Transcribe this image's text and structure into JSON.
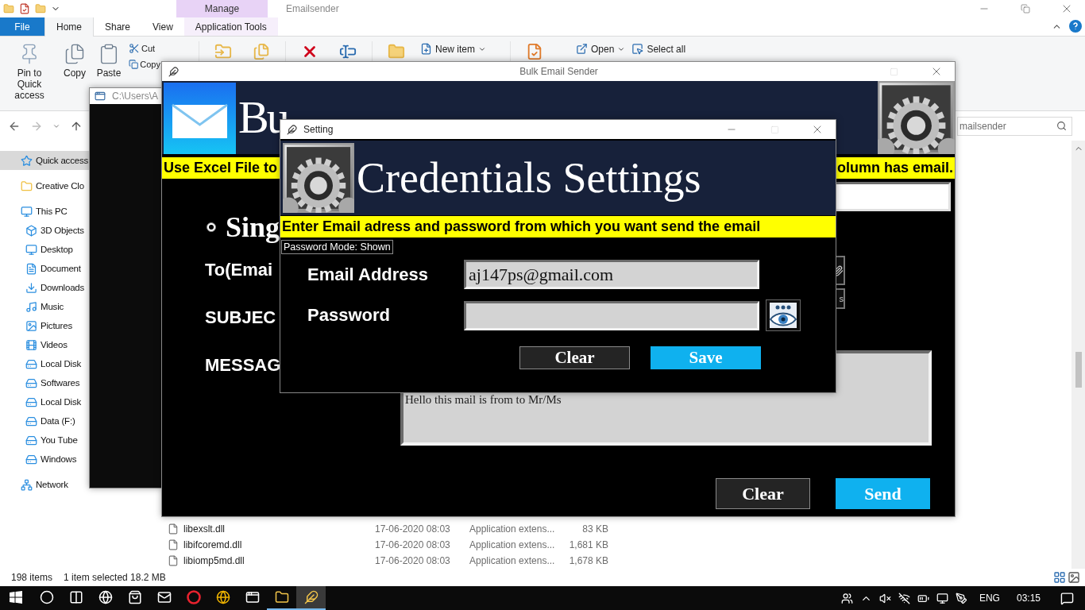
{
  "explorer": {
    "title": "Emailsender",
    "context_group": "Manage",
    "tabs": [
      {
        "label": "File",
        "kind": "file",
        "selected": false
      },
      {
        "label": "Home",
        "kind": "tab",
        "selected": true
      },
      {
        "label": "Share",
        "kind": "tab",
        "selected": false
      },
      {
        "label": "View",
        "kind": "tab",
        "selected": false
      },
      {
        "label": "Application Tools",
        "kind": "context",
        "selected": false
      }
    ],
    "ribbon": {
      "large_buttons": [
        "Pin to Quick access",
        "Copy",
        "Paste"
      ],
      "small_buttons": [
        "Cut",
        "Copy"
      ],
      "menu_buttons": [
        {
          "label": "New item",
          "dropdown": true
        },
        {
          "label": "Open",
          "dropdown": true
        },
        {
          "label": "Select all",
          "dropdown": false
        }
      ]
    },
    "search": {
      "placeholder": "mailsender"
    },
    "nav": [
      {
        "label": "Quick access",
        "selected": true
      },
      {
        "label": "Creative Clo",
        "selected": false
      },
      {
        "label": "This PC",
        "selected": false,
        "children": [
          {
            "label": "3D Objects",
            "selected": false
          },
          {
            "label": "Desktop",
            "selected": false
          },
          {
            "label": "Document",
            "selected": false
          },
          {
            "label": "Downloads",
            "selected": false
          },
          {
            "label": "Music",
            "selected": false
          },
          {
            "label": "Pictures",
            "selected": false
          },
          {
            "label": "Videos",
            "selected": false
          },
          {
            "label": "Local Disk",
            "selected": false
          },
          {
            "label": "Softwares",
            "selected": false
          },
          {
            "label": "Local Disk",
            "selected": false
          },
          {
            "label": "Data  (F:)",
            "selected": false
          },
          {
            "label": "You Tube",
            "selected": false
          },
          {
            "label": "Windows",
            "selected": false
          }
        ]
      },
      {
        "label": "Network",
        "selected": false
      }
    ],
    "files": [
      {
        "name": "libexslt.dll",
        "date": "17-06-2020 08:03",
        "type": "Application extens...",
        "size": "83 KB"
      },
      {
        "name": "libifcoremd.dll",
        "date": "17-06-2020 08:03",
        "type": "Application extens...",
        "size": "1,681 KB"
      },
      {
        "name": "libiomp5md.dll",
        "date": "17-06-2020 08:03",
        "type": "Application extens...",
        "size": "1,678 KB"
      }
    ],
    "status": {
      "count": "198 items",
      "selection": "1 item selected  18.2 MB"
    }
  },
  "console_window": {
    "title": "C:\\Users\\A"
  },
  "bulk_window": {
    "title": "Bulk Email Sender",
    "heading": "Bu",
    "banner_left": "Use Excel File to",
    "banner_right": "olumn has email.",
    "mode_option": {
      "label": "Sing",
      "selected": true
    },
    "labels": [
      "To(Emai",
      "SUBJEC",
      "MESSAG"
    ],
    "side_button_text": "s",
    "message": "Hello this mail is from  to Mr/Ms",
    "buttons": [
      {
        "label": "Clear",
        "kind": "secondary"
      },
      {
        "label": "Send",
        "kind": "primary"
      }
    ]
  },
  "setting_dialog": {
    "title": "Setting",
    "heading": "Credentials Settings",
    "instruction": "Enter Email adress and password from which you want send the email",
    "password_mode": "Password Mode: Shown",
    "fields": [
      {
        "label": "Email Address",
        "value": "aj147ps@gmail.com",
        "kind": "text"
      },
      {
        "label": "Password",
        "kind": "password"
      }
    ],
    "buttons": [
      {
        "label": "Clear",
        "kind": "secondary"
      },
      {
        "label": "Save",
        "kind": "primary"
      }
    ]
  },
  "taskbar": {
    "apps": [
      {
        "running": false
      },
      {
        "running": false
      },
      {
        "running": false
      },
      {
        "running": false
      },
      {
        "running": false
      },
      {
        "running": false
      },
      {
        "running": false
      },
      {
        "running": true
      },
      {
        "running": true
      }
    ],
    "language": "ENG",
    "time": "03:15"
  }
}
